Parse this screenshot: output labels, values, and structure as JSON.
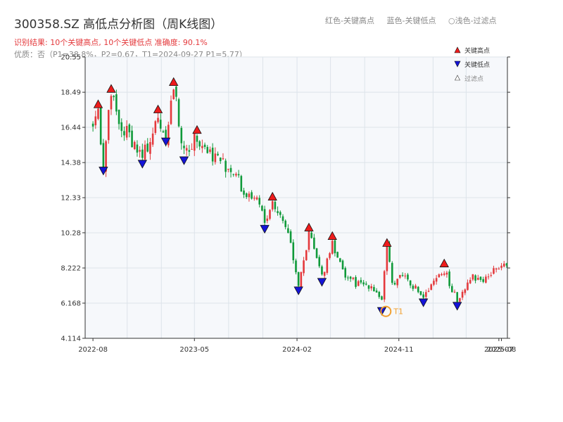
{
  "header": {
    "title": "300358.SZ 高低点分析图（周K线图）",
    "result_line": "识别结果: 10个关键高点, 10个关键低点   准确度: 90.1%",
    "info_line": "优质：否（P1=38.8%，P2=0.67，T1=2024-09-27 P1=5.77）"
  },
  "top_legend": {
    "red": "红色-关键高点",
    "blue": "蓝色-关键低点",
    "light": "○浅色-过滤点"
  },
  "colors": {
    "up": "#e4393c",
    "down": "#109a3a",
    "high_marker": "#ee1c1c",
    "low_marker": "#1414d8",
    "t1": "#f0a030",
    "grid": "#dde3ea",
    "plot_bg": "#f6f8fb"
  },
  "chart_data": {
    "type": "candlestick",
    "ylim": [
      4.114,
      20.55
    ],
    "ytick_labels": [
      "4.114",
      "6.168",
      "8.222",
      "10.28",
      "12.33",
      "14.38",
      "16.44",
      "18.49",
      "20.55"
    ],
    "xtick_labels": [
      "2022-08",
      "2023-05",
      "2024-02",
      "2024-11",
      "2025-07",
      "2025-08"
    ],
    "x_range": [
      "2022-08",
      "2025-08"
    ],
    "legend": [
      "关键高点",
      "关键低点",
      "过滤点"
    ],
    "annotation": "T1",
    "anchors": [
      [
        "2022-08-01",
        16.5
      ],
      [
        "2022-08-15",
        17.5
      ],
      [
        "2022-08-29",
        14.2
      ],
      [
        "2022-09-19",
        18.4
      ],
      [
        "2022-10-10",
        16.4
      ],
      [
        "2022-11-07",
        16.0
      ],
      [
        "2022-12-12",
        14.6
      ],
      [
        "2023-01-23",
        16.9
      ],
      [
        "2023-02-13",
        15.9
      ],
      [
        "2023-03-06",
        18.8
      ],
      [
        "2023-04-03",
        14.8
      ],
      [
        "2023-05-08",
        16.0
      ],
      [
        "2023-06-05",
        15.1
      ],
      [
        "2023-07-10",
        14.5
      ],
      [
        "2023-08-21",
        13.7
      ],
      [
        "2023-09-11",
        12.5
      ],
      [
        "2023-10-09",
        12.7
      ],
      [
        "2023-11-06",
        10.9
      ],
      [
        "2023-11-27",
        12.1
      ],
      [
        "2024-01-08",
        10.4
      ],
      [
        "2024-02-05",
        7.3
      ],
      [
        "2024-03-04",
        10.3
      ],
      [
        "2024-04-08",
        7.7
      ],
      [
        "2024-05-06",
        9.8
      ],
      [
        "2024-06-03",
        8.0
      ],
      [
        "2024-07-08",
        7.3
      ],
      [
        "2024-08-19",
        7.2
      ],
      [
        "2024-09-16",
        6.4
      ],
      [
        "2024-09-30",
        9.4
      ],
      [
        "2024-10-14",
        7.3
      ],
      [
        "2024-11-11",
        7.9
      ],
      [
        "2025-01-06",
        6.5
      ],
      [
        "2025-03-03",
        8.1
      ],
      [
        "2025-04-07",
        6.3
      ],
      [
        "2025-05-12",
        7.7
      ],
      [
        "2025-06-16",
        7.5
      ],
      [
        "2025-07-14",
        8.0
      ],
      [
        "2025-08-04",
        8.6
      ],
      [
        "2025-08-18",
        8.6
      ]
    ],
    "key_highs": [
      {
        "date": "2022-08-15",
        "price": 17.5
      },
      {
        "date": "2022-09-19",
        "price": 18.4
      },
      {
        "date": "2023-01-23",
        "price": 17.2
      },
      {
        "date": "2023-03-06",
        "price": 18.8
      },
      {
        "date": "2023-05-08",
        "price": 16.0
      },
      {
        "date": "2023-11-27",
        "price": 12.1
      },
      {
        "date": "2024-03-04",
        "price": 10.3
      },
      {
        "date": "2024-05-06",
        "price": 9.8
      },
      {
        "date": "2024-09-30",
        "price": 9.4
      },
      {
        "date": "2025-03-03",
        "price": 8.2
      }
    ],
    "key_lows": [
      {
        "date": "2022-08-29",
        "price": 14.2
      },
      {
        "date": "2022-12-12",
        "price": 14.6
      },
      {
        "date": "2023-02-13",
        "price": 15.9
      },
      {
        "date": "2023-04-03",
        "price": 14.8
      },
      {
        "date": "2023-11-06",
        "price": 10.8
      },
      {
        "date": "2024-02-05",
        "price": 7.2
      },
      {
        "date": "2024-04-08",
        "price": 7.7
      },
      {
        "date": "2024-09-16",
        "price": 6.0
      },
      {
        "date": "2025-01-06",
        "price": 6.5
      },
      {
        "date": "2025-04-07",
        "price": 6.3
      }
    ],
    "t1": {
      "date": "2024-09-27",
      "price": 5.77
    }
  }
}
